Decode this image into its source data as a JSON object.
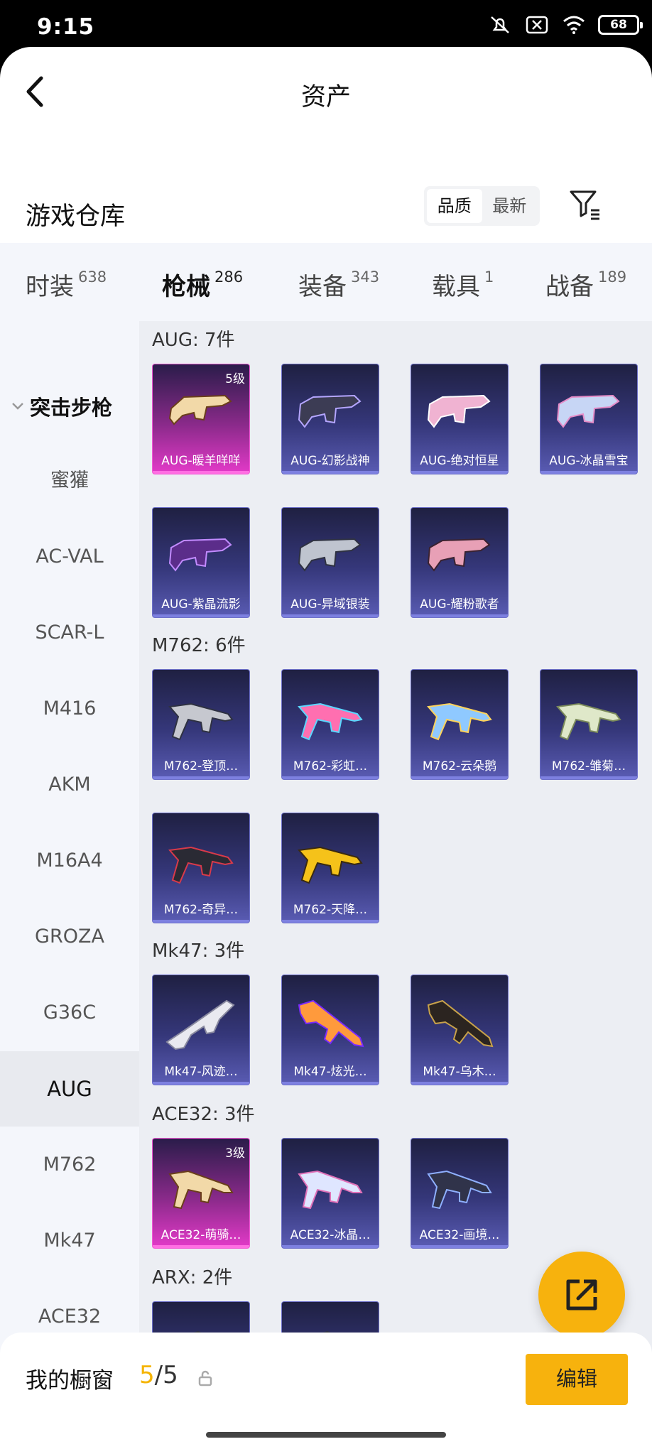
{
  "status": {
    "time": "9:15",
    "battery": "68"
  },
  "header": {
    "title": "资产"
  },
  "warehouse": {
    "title": "游戏仓库",
    "sort_options": [
      "品质",
      "最新"
    ]
  },
  "tabs": [
    {
      "label": "时装",
      "count": "638"
    },
    {
      "label": "枪械",
      "count": "286"
    },
    {
      "label": "装备",
      "count": "343"
    },
    {
      "label": "载具",
      "count": "1"
    },
    {
      "label": "战备",
      "count": "189"
    }
  ],
  "sidebar": {
    "group": "突击步枪",
    "items": [
      "蜜獾",
      "AC-VAL",
      "SCAR-L",
      "M416",
      "AKM",
      "M16A4",
      "GROZA",
      "G36C",
      "AUG",
      "M762",
      "Mk47",
      "ACE32"
    ],
    "active": "AUG"
  },
  "sections": [
    {
      "label": "AUG: 7件",
      "items": [
        {
          "name": "AUG-暖羊咩咩",
          "grade": "5级",
          "rarity": "gold"
        },
        {
          "name": "AUG-幻影战神"
        },
        {
          "name": "AUG-绝对恒星"
        },
        {
          "name": "AUG-冰晶雪宝"
        },
        {
          "name": "AUG-紫晶流影"
        },
        {
          "name": "AUG-异域银装"
        },
        {
          "name": "AUG-耀粉歌者"
        }
      ]
    },
    {
      "label": "M762: 6件",
      "items": [
        {
          "name": "M762-登顶…"
        },
        {
          "name": "M762-彩虹…"
        },
        {
          "name": "M762-云朵鹅"
        },
        {
          "name": "M762-雏菊…"
        },
        {
          "name": "M762-奇异…"
        },
        {
          "name": "M762-天降…"
        }
      ]
    },
    {
      "label": "Mk47: 3件",
      "items": [
        {
          "name": "Mk47-风迹…"
        },
        {
          "name": "Mk47-炫光…"
        },
        {
          "name": "Mk47-乌木…"
        }
      ]
    },
    {
      "label": "ACE32: 3件",
      "items": [
        {
          "name": "ACE32-萌骑…",
          "grade": "3级",
          "rarity": "gold"
        },
        {
          "name": "ACE32-冰晶…"
        },
        {
          "name": "ACE32-画境…"
        }
      ]
    },
    {
      "label": "ARX: 2件",
      "items": [
        {
          "name": ""
        },
        {
          "name": ""
        }
      ]
    }
  ],
  "showcase": {
    "label": "我的橱窗",
    "current": "5",
    "separator": "/",
    "total": "5"
  },
  "edit_button": "编辑",
  "colors": {
    "accent": "#f7b20d",
    "card": "#35377a",
    "card_gold": "#e43ac9"
  }
}
